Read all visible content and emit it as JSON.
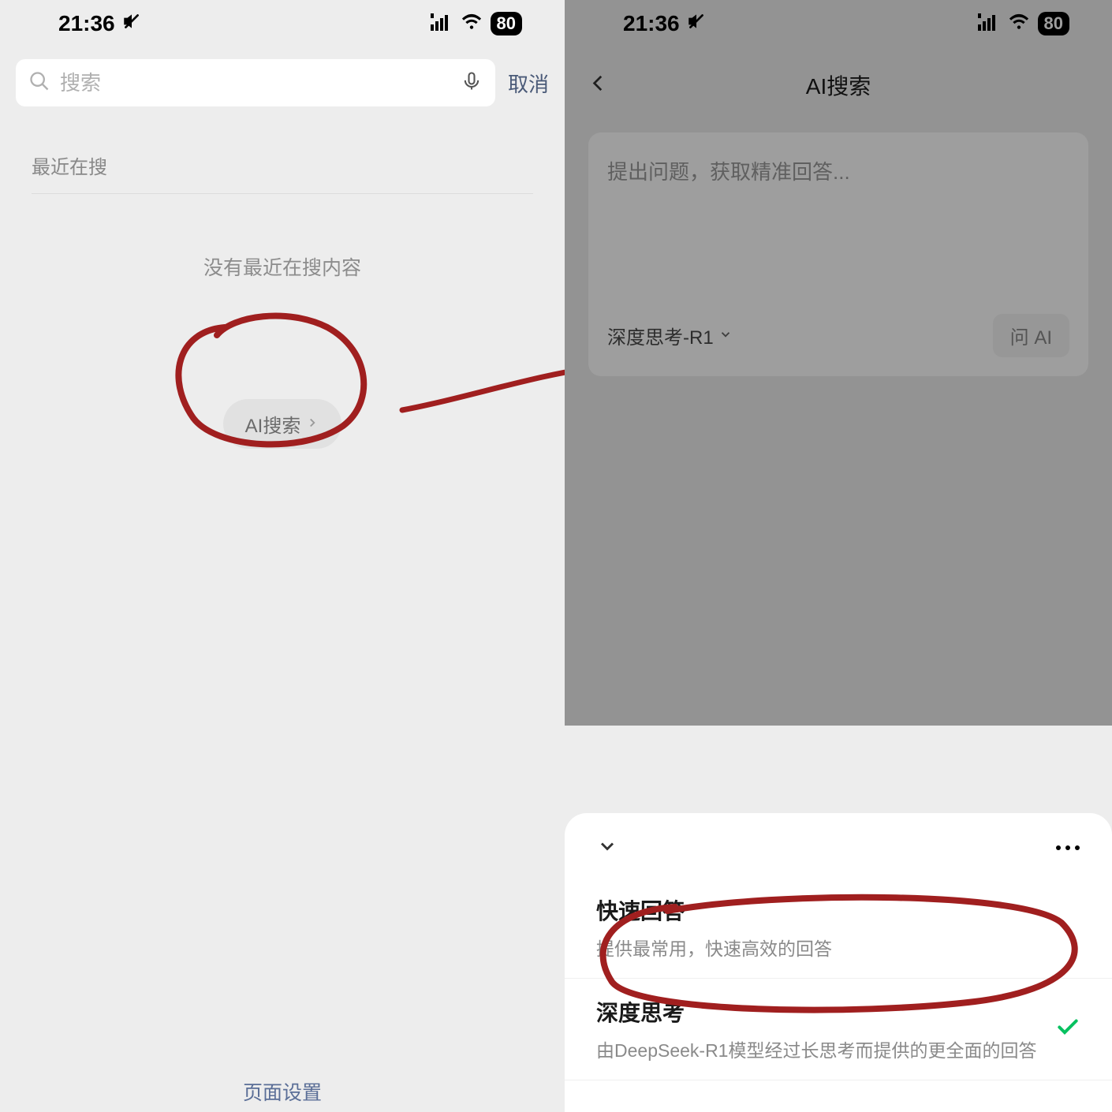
{
  "status": {
    "time": "21:36",
    "battery": "80"
  },
  "left": {
    "search_placeholder": "搜索",
    "cancel": "取消",
    "recent_header": "最近在搜",
    "empty_text": "没有最近在搜内容",
    "ai_search": "AI搜索",
    "page_settings": "页面设置"
  },
  "right": {
    "title": "AI搜索",
    "input_placeholder": "提出问题，获取精准回答...",
    "model_label": "深度思考-R1",
    "ask_ai": "问 AI"
  },
  "sheet": {
    "options": [
      {
        "title": "快速回答",
        "desc": "提供最常用，快速高效的回答",
        "selected": false
      },
      {
        "title": "深度思考",
        "desc": "由DeepSeek-R1模型经过长思考而提供的更全面的回答",
        "selected": true
      }
    ]
  }
}
